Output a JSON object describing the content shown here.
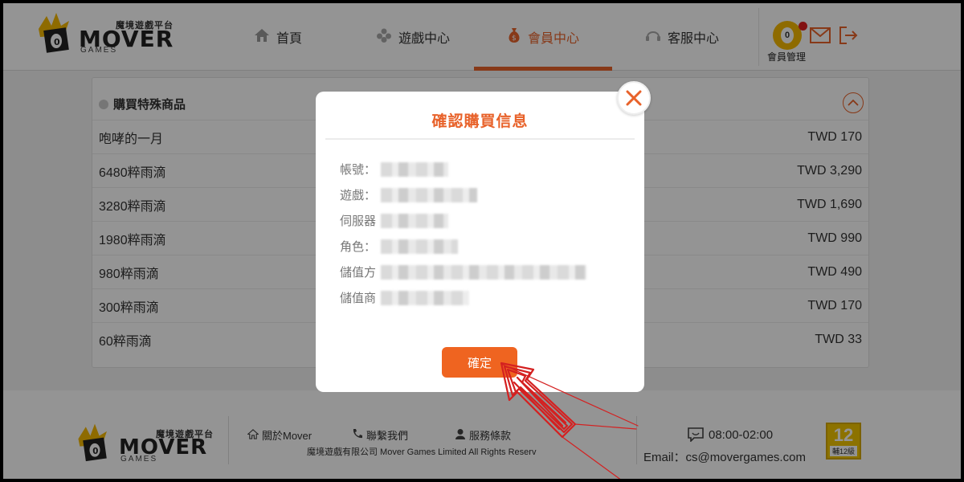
{
  "header": {
    "logo": {
      "chinese": "魔境遊戲平台",
      "brand": "MOVER",
      "sub": "GAMES"
    },
    "nav": [
      {
        "label": "首頁",
        "icon": "home-icon"
      },
      {
        "label": "遊戲中心",
        "icon": "gamepad-icon"
      },
      {
        "label": "會員中心",
        "icon": "money-bag-icon",
        "active": true
      },
      {
        "label": "客服中心",
        "icon": "headset-icon"
      }
    ],
    "member_label": "會員管理",
    "member_badge": "0",
    "accent_color": "#e8622a"
  },
  "panel": {
    "title": "購買特殊商品",
    "products": [
      {
        "name": "咆哮的一月",
        "price": "TWD 170"
      },
      {
        "name": "6480粹雨滴",
        "price": "TWD 3,290"
      },
      {
        "name": "3280粹雨滴",
        "price": "TWD 1,690"
      },
      {
        "name": "1980粹雨滴",
        "price": "TWD 990"
      },
      {
        "name": "980粹雨滴",
        "price": "TWD 490"
      },
      {
        "name": "300粹雨滴",
        "price": "TWD 170"
      },
      {
        "name": "60粹雨滴",
        "price": "TWD 33"
      }
    ]
  },
  "modal": {
    "title": "確認購買信息",
    "fields": [
      {
        "label": "帳號："
      },
      {
        "label": "遊戲："
      },
      {
        "label": "伺服器"
      },
      {
        "label": "角色："
      },
      {
        "label": "儲值方"
      },
      {
        "label": "儲值商"
      }
    ],
    "confirm_label": "確定"
  },
  "footer": {
    "logo": {
      "chinese": "魔境遊戲平台",
      "brand": "MOVER",
      "sub": "GAMES"
    },
    "links": [
      {
        "label": "關於Mover",
        "icon": "home-icon"
      },
      {
        "label": "聯繫我們",
        "icon": "phone-icon"
      },
      {
        "label": "服務條款",
        "icon": "user-icon"
      }
    ],
    "copyright": "魔境遊戲有限公司 Mover Games Limited All Rights Reserv",
    "hours": "08:00-02:00",
    "email": "Email：cs@movergames.com",
    "rating": {
      "number": "12",
      "label": "輔12級"
    }
  }
}
